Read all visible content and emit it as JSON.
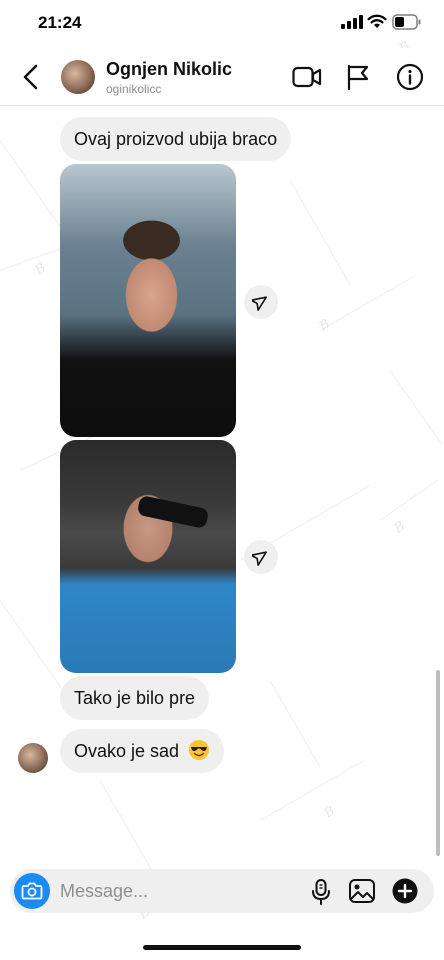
{
  "status_bar": {
    "time": "21:24"
  },
  "header": {
    "name": "Ognjen Nikolic",
    "username": "oginikolicc"
  },
  "messages": [
    {
      "type": "text",
      "text": "Ovaj proizvod ubija braco"
    },
    {
      "type": "photo",
      "subject": "man-by-water"
    },
    {
      "type": "photo",
      "subject": "man-with-sunglasses-in-car"
    },
    {
      "type": "text",
      "text": "Tako je bilo pre"
    },
    {
      "type": "text",
      "text": "Ovako je sad",
      "emoji": "smiling-face-with-sunglasses"
    }
  ],
  "composer": {
    "placeholder": "Message..."
  },
  "icons": {
    "back": "chevron-left-icon",
    "video": "video-camera-icon",
    "report": "flag-icon",
    "info": "info-icon",
    "share": "send-arrow-icon",
    "camera": "camera-icon",
    "mic": "microphone-icon",
    "gallery": "image-icon",
    "add": "plus-circle-icon"
  },
  "colors": {
    "accent": "#1a8cf0",
    "bubble": "#efefef",
    "secondary_text": "#8e8e8e"
  }
}
